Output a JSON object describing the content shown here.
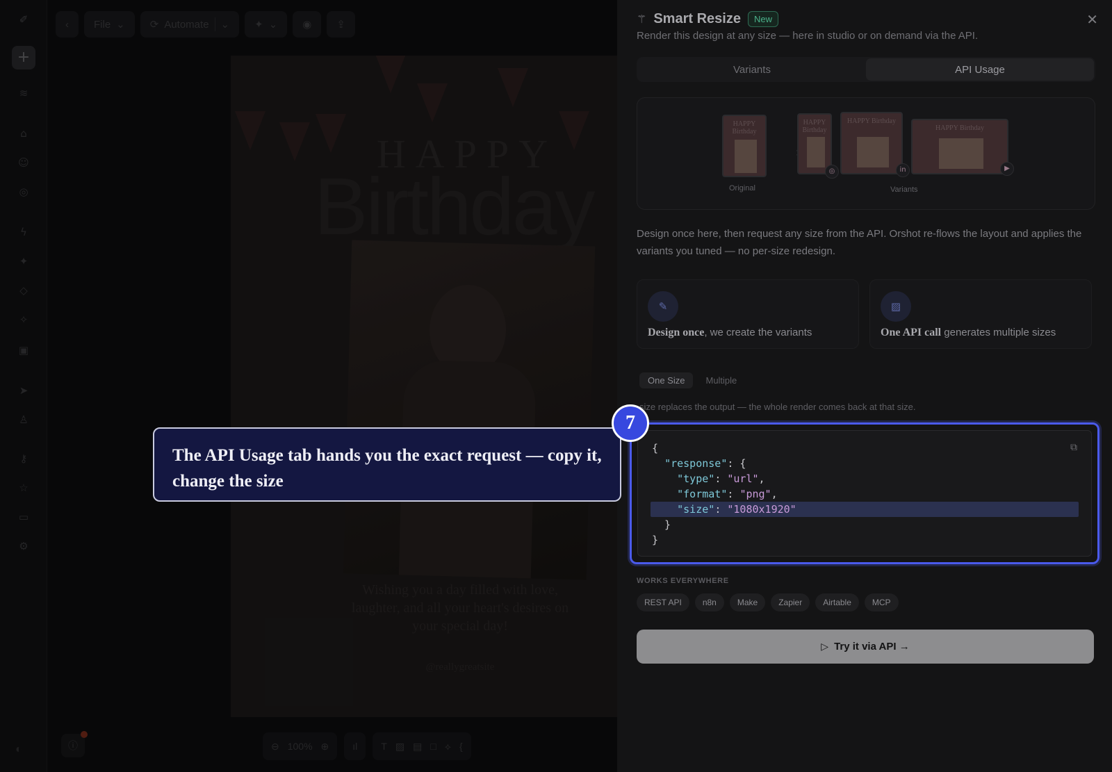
{
  "toolbar": {
    "back_icon": "chevron-left-icon",
    "file_label": "File",
    "automate_label": "Automate"
  },
  "poster": {
    "happy": "HAPPY",
    "birthday": "Birthday",
    "wish": "Wishing you a day filled with love, laughter, and all your heart's desires on your special day!",
    "handle": "@reallygreatsite"
  },
  "zoom": "100%",
  "panel": {
    "title": "Smart Resize",
    "badge": "New",
    "subtitle": "Render this design at any size — here in studio or on demand via the API.",
    "tabs": [
      {
        "label": "Variants",
        "active": false
      },
      {
        "label": "API Usage",
        "active": true
      }
    ],
    "preview": {
      "original_caption": "Original",
      "variants_caption": "Variants",
      "thumb_text": "HAPPY Birthday"
    },
    "description": "Design once here, then request any size from the API. Orshot re-flows the layout and applies the variants you tuned — no per-size redesign.",
    "cards": [
      {
        "bold": "Design once",
        "text": ", we create the variants"
      },
      {
        "bold": "One API call",
        "text": " generates multiple sizes"
      }
    ],
    "segment": [
      {
        "label": "One Size",
        "active": true
      },
      {
        "label": "Multiple",
        "active": false
      }
    ],
    "hint": "size replaces the output — the whole render comes back at that size.",
    "code": {
      "l1": "{",
      "response_key": "\"response\"",
      "type_key": "\"type\"",
      "type_val": "\"url\"",
      "format_key": "\"format\"",
      "format_val": "\"png\"",
      "size_key": "\"size\"",
      "size_val": "\"1080x1920\"",
      "l6": "  }",
      "l7": "}"
    },
    "works_label": "WORKS EVERYWHERE",
    "chips": [
      "REST API",
      "n8n",
      "Make",
      "Zapier",
      "Airtable",
      "MCP"
    ],
    "try_label": "Try it via API →"
  },
  "callout": {
    "step": "7",
    "text": "The API Usage tab hands you the exact request — copy it, change the size"
  },
  "colors": {
    "accent": "#4a5aeb",
    "callout_bg": "#141741",
    "badge_green": "#4bb08a"
  }
}
